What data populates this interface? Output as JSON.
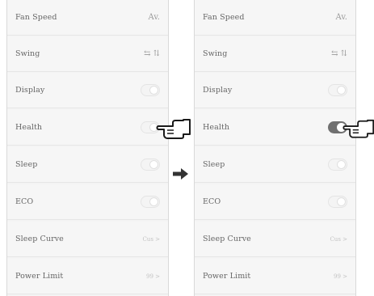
{
  "left_panel": {
    "rows": [
      {
        "label": "Fan Speed",
        "control": "Av.",
        "type": "text"
      },
      {
        "label": "Swing",
        "control": "⇆ ⇅",
        "type": "text"
      },
      {
        "label": "Display",
        "state": "off",
        "type": "toggle"
      },
      {
        "label": "Health",
        "state": "off",
        "type": "toggle"
      },
      {
        "label": "Sleep",
        "state": "off",
        "type": "toggle"
      },
      {
        "label": "ECO",
        "state": "off",
        "type": "toggle"
      },
      {
        "label": "Sleep Curve",
        "control": "Cus >",
        "type": "text"
      },
      {
        "label": "Power Limit",
        "control": "99 >",
        "type": "text"
      }
    ]
  },
  "right_panel": {
    "rows": [
      {
        "label": "Fan Speed",
        "control": "Av.",
        "type": "text"
      },
      {
        "label": "Swing",
        "control": "⇆ ⇅",
        "type": "text"
      },
      {
        "label": "Display",
        "state": "off",
        "type": "toggle"
      },
      {
        "label": "Health",
        "state": "on",
        "type": "toggle"
      },
      {
        "label": "Sleep",
        "state": "off",
        "type": "toggle"
      },
      {
        "label": "ECO",
        "state": "off",
        "type": "toggle"
      },
      {
        "label": "Sleep Curve",
        "control": "Cus >",
        "type": "text"
      },
      {
        "label": "Power Limit",
        "control": "99 >",
        "type": "text"
      }
    ]
  },
  "icons": {
    "pointer": "pointing-hand-icon",
    "transition": "right-arrow-icon"
  }
}
